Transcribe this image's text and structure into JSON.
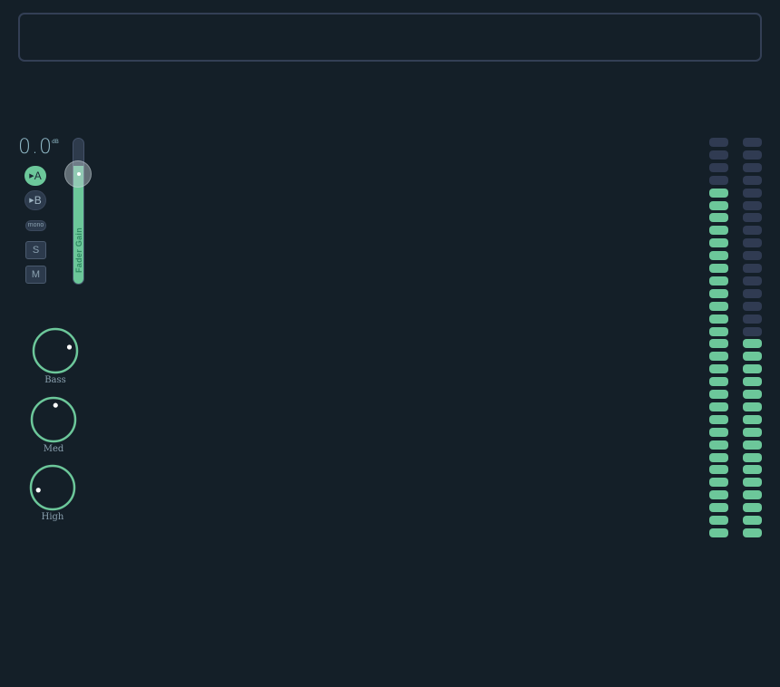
{
  "channel": {
    "gain_value": "0.0",
    "gain_unit": "dB",
    "buttons": {
      "a_label": "A",
      "b_label": "B",
      "a_active": true,
      "b_active": false,
      "mono_label": "mono",
      "solo_label": "S",
      "mute_label": "M"
    },
    "fader": {
      "label": "Fader Gain",
      "level": 0.8
    },
    "eq": [
      {
        "label": "Bass",
        "value": 0.78
      },
      {
        "label": "Med",
        "value": 0.53
      },
      {
        "label": "High",
        "value": 0.13
      }
    ]
  },
  "meters": {
    "total_segments": 32,
    "left_lit": 28,
    "right_lit": 16
  },
  "colors": {
    "accent": "#6cc79a",
    "background": "#141f28",
    "segment_off": "#303b52",
    "border": "#333f55"
  }
}
